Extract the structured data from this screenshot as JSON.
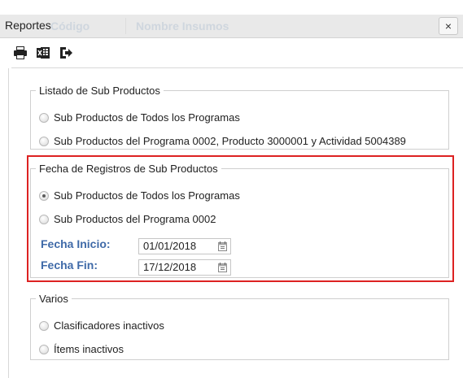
{
  "dialog": {
    "title": "Reportes",
    "close_label": "×",
    "background_headers": [
      "Código",
      "Nombre Insumos"
    ]
  },
  "toolbar": {
    "icons": [
      "printer-icon",
      "excel-icon",
      "exit-icon"
    ]
  },
  "listado": {
    "legend": "Listado de Sub Productos",
    "options": [
      {
        "label": "Sub Productos de Todos los Programas",
        "checked": false
      },
      {
        "label": "Sub Productos del Programa 0002, Producto 3000001 y Actividad 5004389",
        "checked": false
      }
    ]
  },
  "fecha": {
    "legend": "Fecha de Registros de Sub Productos",
    "options": [
      {
        "label": "Sub Productos de Todos los Programas",
        "checked": true
      },
      {
        "label": "Sub Productos del Programa 0002",
        "checked": false
      }
    ],
    "inicio_label": "Fecha Inicio:",
    "inicio_value": "01/01/2018",
    "fin_label": "Fecha Fin:",
    "fin_value": "17/12/2018"
  },
  "varios": {
    "legend": "Varios",
    "options": [
      {
        "label": "Clasificadores inactivos",
        "checked": false
      },
      {
        "label": "Ítems inactivos",
        "checked": false
      }
    ]
  },
  "colors": {
    "accent_label": "#3f6aa8",
    "highlight_border": "#dd2222"
  }
}
